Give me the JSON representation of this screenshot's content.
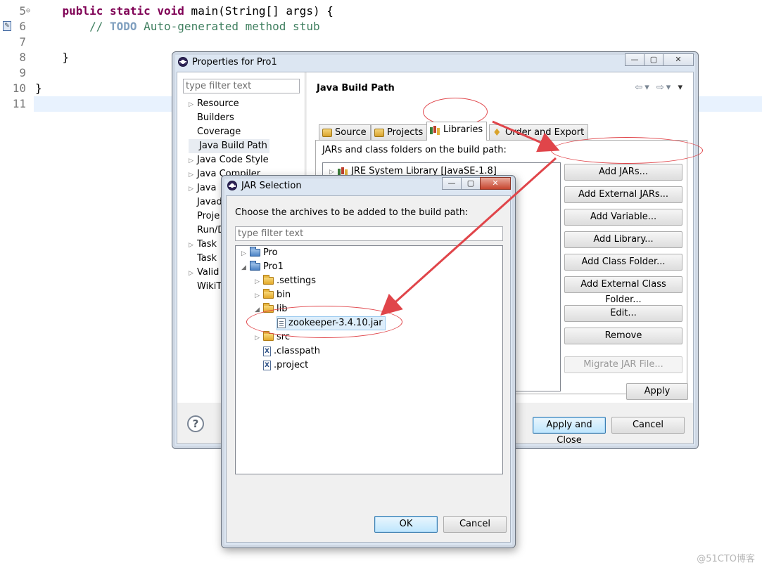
{
  "editor": {
    "lines": [
      {
        "num": "5",
        "parts": [
          [
            "    ",
            ""
          ],
          [
            "public static void",
            "kw"
          ],
          [
            " main(String[] args) {",
            ""
          ]
        ],
        "fold": "⊖"
      },
      {
        "num": "6",
        "parts": [
          [
            "        ",
            ""
          ],
          [
            "// ",
            "cm"
          ],
          [
            "TODO",
            "todo"
          ],
          [
            " Auto-generated method stub",
            "cm"
          ]
        ]
      },
      {
        "num": "7",
        "parts": []
      },
      {
        "num": "8",
        "parts": [
          [
            "    }",
            ""
          ]
        ]
      },
      {
        "num": "9",
        "parts": []
      },
      {
        "num": "10",
        "parts": [
          [
            "}",
            ""
          ]
        ]
      },
      {
        "num": "11",
        "parts": []
      }
    ]
  },
  "properties": {
    "title": "Properties for Pro1",
    "filter_placeholder": "type filter text",
    "nav": [
      "Resource",
      "Builders",
      "Coverage",
      "Java Build Path",
      "Java Code Style",
      "Java Compiler",
      "Java Editor",
      "Javadoc Location",
      "Project Facets",
      "Run/Debug Settings",
      "Task Repository",
      "Task Tags",
      "Validation",
      "WikiText"
    ],
    "nav_visible": [
      "Resource",
      "Builders",
      "Coverage",
      "Java Build Path",
      "Java Code Style",
      "Java Compiler",
      "Java",
      "Javad",
      "Proje",
      "Run/D",
      "Task",
      "Task",
      "Valid",
      "WikiT"
    ],
    "section_title": "Java Build Path",
    "tabs": [
      "Source",
      "Projects",
      "Libraries",
      "Order and Export"
    ],
    "list_label": "JARs and class folders on the build path:",
    "libraries": [
      "JRE System Library [JavaSE-1.8]"
    ],
    "buttons": {
      "add_jars": "Add JARs...",
      "add_external_jars": "Add External JARs...",
      "add_variable": "Add Variable...",
      "add_library": "Add Library...",
      "add_class_folder": "Add Class Folder...",
      "add_external_class_folder": "Add External Class Folder...",
      "edit": "Edit...",
      "remove": "Remove",
      "migrate": "Migrate JAR File...",
      "apply": "Apply",
      "apply_close": "Apply and Close",
      "cancel": "Cancel"
    }
  },
  "jar_dialog": {
    "title": "JAR Selection",
    "prompt": "Choose the archives to be added to the build path:",
    "filter_placeholder": "type filter text",
    "tree": {
      "pro": "Pro",
      "pro1": "Pro1",
      "settings": ".settings",
      "bin": "bin",
      "lib": "lib",
      "jar": "zookeeper-3.4.10.jar",
      "src": "src",
      "classpath": ".classpath",
      "project": ".project"
    },
    "ok": "OK",
    "cancel": "Cancel"
  },
  "watermark": "@51CTO博客",
  "colors": {
    "annotation": "#e0454a",
    "keyword": "#7f0055",
    "comment": "#3f7f5f",
    "current_line": "#e8f2fe"
  }
}
